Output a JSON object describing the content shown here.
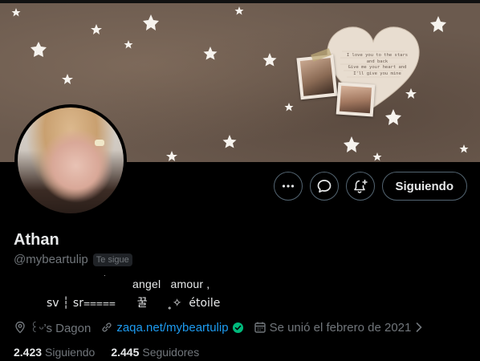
{
  "profile": {
    "display_name": "Athan",
    "handle": "@mybeartulip",
    "follows_you_badge": "Te sigue",
    "bio_line1": "angel   amour ,",
    "bio_line2": "sv ┆ sr⩶⩵      꿀       ̥✧  étoile",
    "location": "꒰ᵕ’s Dagon",
    "website": "zaqa.net/mybeartulip",
    "joined": "Se unió el febrero de 2021",
    "following_count": "2.423",
    "following_label": "Siguiendo",
    "followers_count": "2.445",
    "followers_label": "Seguidores"
  },
  "banner": {
    "note_text": "I love you to the stars\nand back\nGive me your heart and\nI'll give you mine"
  },
  "actions": {
    "more_icon": "more-horizontal-icon",
    "message_icon": "message-bubble-icon",
    "notify_icon": "bell-plus-icon",
    "follow_label": "Siguiendo"
  },
  "colors": {
    "accent": "#1d9bf0",
    "muted": "#71767b",
    "border": "#536471",
    "verified": "#00ba7c"
  }
}
